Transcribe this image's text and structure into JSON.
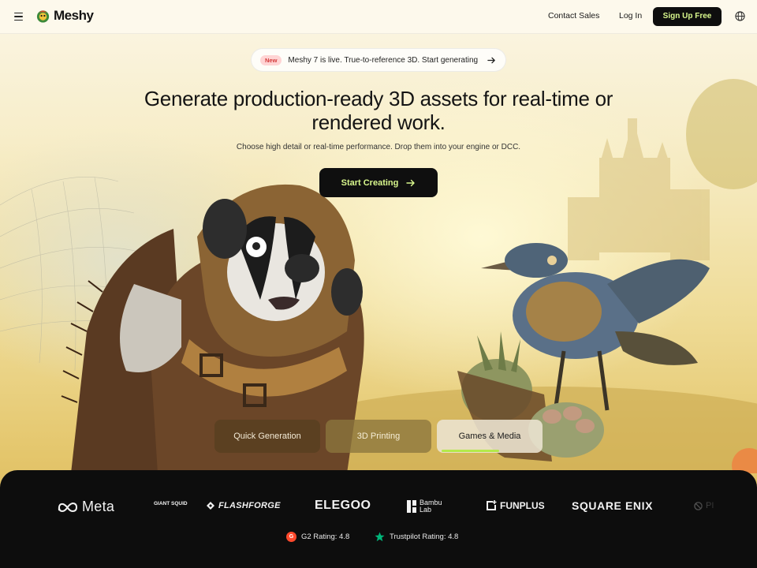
{
  "header": {
    "logo_text": "Meshy",
    "contact_label": "Contact Sales",
    "login_label": "Log In",
    "signup_label": "Sign Up Free"
  },
  "announcement": {
    "badge": "New",
    "text": "Meshy 7 is live. True-to-reference 3D. Start generating"
  },
  "hero": {
    "headline": "Generate production-ready 3D assets for real-time or rendered work.",
    "subheadline": "Choose high detail or real-time performance. Drop them into your engine or DCC.",
    "cta_label": "Start Creating"
  },
  "tabs": [
    {
      "label": "Quick Generation",
      "active": false
    },
    {
      "label": "3D Printing",
      "active": false
    },
    {
      "label": "Games & Media",
      "active": true
    }
  ],
  "active_tab_progress": 0.6,
  "partners": {
    "meta": "Meta",
    "gs": "GIANT SQUID",
    "flashforge": "FLASHFORGE",
    "elegoo": "ELEGOO",
    "bambu_line1": "Bambu",
    "bambu_line2": "Lab",
    "funplus": "FUNPLUS",
    "square_enix": "SQUARE ENIX",
    "cut_off": "PI"
  },
  "ratings": {
    "g2": "G2 Rating: 4.8",
    "trustpilot": "Trustpilot Rating: 4.8"
  },
  "colors": {
    "accent_lime": "#d9f88d",
    "dark": "#0e0e0e",
    "g2_red": "#ff492c",
    "trustpilot_green": "#00b67a",
    "new_badge_bg": "#ffd4d4"
  },
  "icons": [
    "menu-icon",
    "meshy-logo-icon",
    "globe-icon",
    "arrow-right-icon",
    "g2-icon",
    "trustpilot-star-icon"
  ]
}
